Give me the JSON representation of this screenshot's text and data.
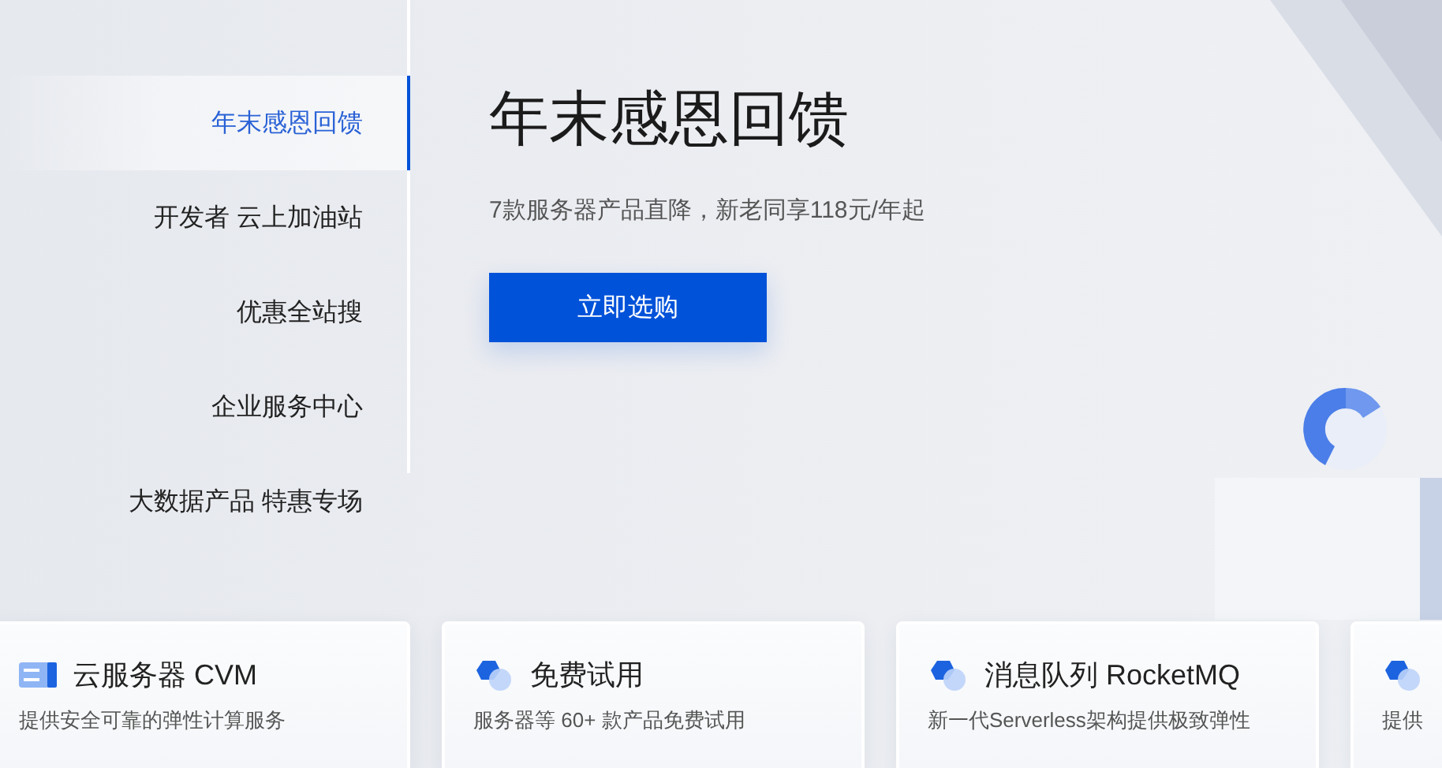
{
  "sidebar": {
    "items": [
      {
        "label": "年末感恩回馈",
        "selected": true
      },
      {
        "label": "开发者 云上加油站",
        "selected": false
      },
      {
        "label": "优惠全站搜",
        "selected": false
      },
      {
        "label": "企业服务中心",
        "selected": false
      },
      {
        "label": "大数据产品 特惠专场",
        "selected": false
      }
    ]
  },
  "banner": {
    "title": "年末感恩回馈",
    "subtitle": "7款服务器产品直降，新老同享118元/年起",
    "button": "立即选购"
  },
  "cards": [
    {
      "kind": "server",
      "title": "云服务器 CVM",
      "description": "提供安全可靠的弹性计算服务"
    },
    {
      "kind": "cloud",
      "title": "免费试用",
      "description": "服务器等 60+ 款产品免费试用"
    },
    {
      "kind": "cloud",
      "title": "消息队列 RocketMQ",
      "description": "新一代Serverless架构提供极致弹性"
    },
    {
      "kind": "cloud",
      "description": "提供"
    }
  ]
}
